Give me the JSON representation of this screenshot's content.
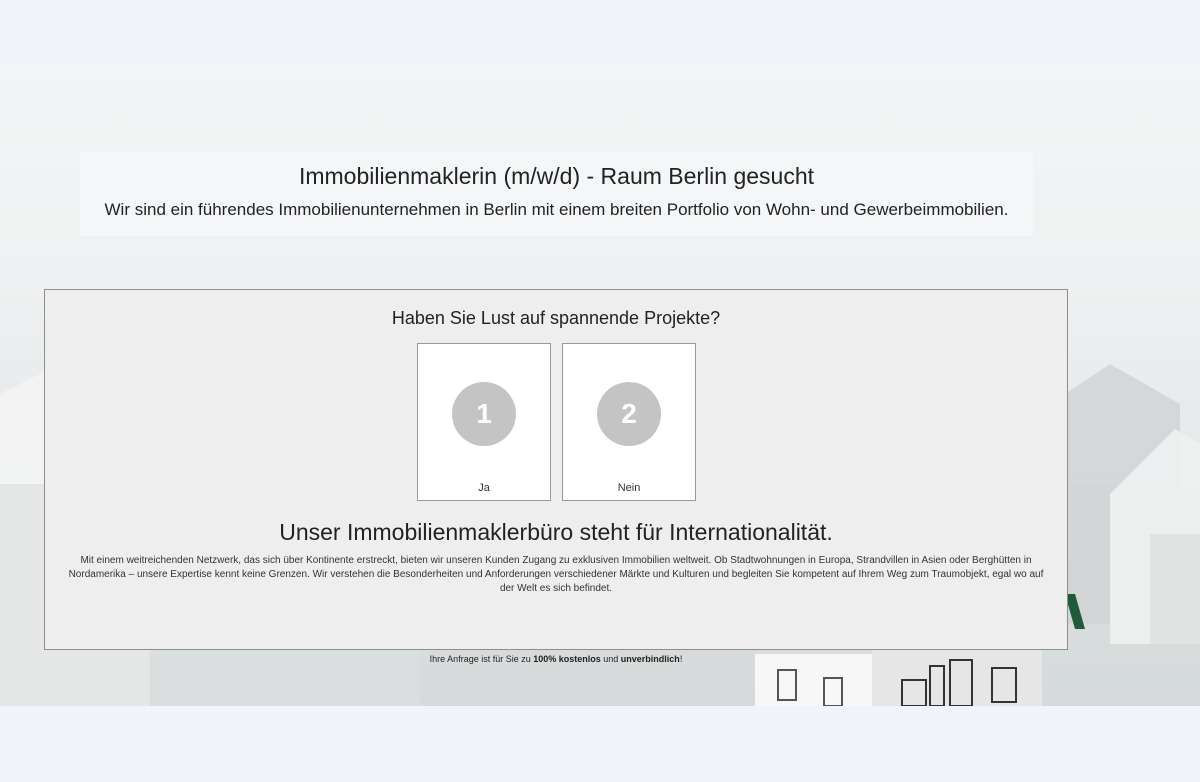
{
  "header": {
    "headline": "Immobilienmaklerin (m/w/d) - Raum Berlin gesucht",
    "subline": "Wir sind ein führendes Immobilienunternehmen in Berlin mit einem breiten Portfolio von Wohn- und Gewerbeimmobilien."
  },
  "survey": {
    "question": "Haben Sie Lust auf spannende Projekte?",
    "options": [
      {
        "number": "1",
        "label": "Ja"
      },
      {
        "number": "2",
        "label": "Nein"
      }
    ],
    "section_title": "Unser Immobilienmaklerbüro steht für Internationalität.",
    "section_body": "Mit einem weitreichenden Netzwerk, das sich über Kontinente erstreckt, bieten wir unseren Kunden Zugang zu exklusiven Immobilien weltweit. Ob Stadtwohnungen in Europa, Strandvillen in Asien oder Berghütten in Nordamerika – unsere Expertise kennt keine Grenzen. Wir verstehen die Besonderheiten und Anforderungen verschiedener Märkte und Kulturen und begleiten Sie kompetent auf Ihrem Weg zum Traumobjekt, egal wo auf der Welt es sich befindet."
  },
  "footnote": {
    "prefix": "Ihre Anfrage ist für Sie zu ",
    "free": "100% kostenlos",
    "middle": " und ",
    "nonbinding": "unverbindlich",
    "suffix": "!"
  },
  "colors": {
    "page_bg": "#f1f5f9",
    "card_bg": "#eeeeee",
    "number_circle": "#c4c4c4",
    "roof_accent": "#1f5a3a"
  }
}
